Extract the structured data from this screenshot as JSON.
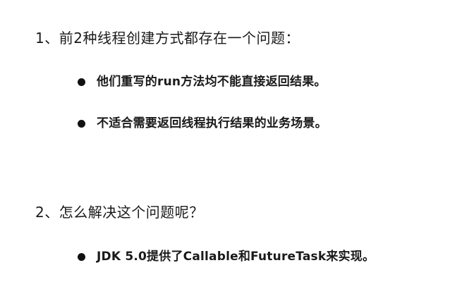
{
  "sections": [
    {
      "heading": "1、前2种线程创建方式都存在一个问题：",
      "bullets": [
        "他们重写的run方法均不能直接返回结果。",
        "不适合需要返回线程执行结果的业务场景。"
      ]
    },
    {
      "heading": "2、怎么解决这个问题呢？",
      "bullets": [
        "JDK 5.0提供了Callable和FutureTask来实现。"
      ]
    }
  ]
}
